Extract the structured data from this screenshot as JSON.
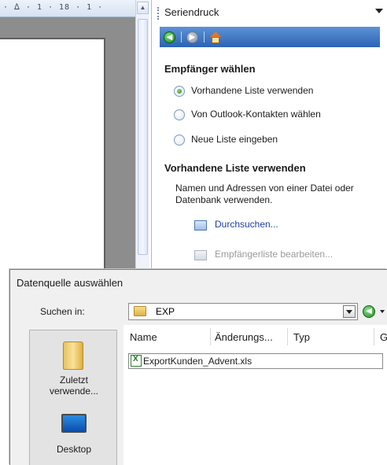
{
  "document": {
    "ruler_text": "· ᐃ · 1 · 18 · 1 ·"
  },
  "task_pane": {
    "title": "Seriendruck",
    "nav": {
      "back_icon": "back-arrow-icon",
      "forward_icon": "forward-arrow-icon",
      "home_icon": "home-icon"
    },
    "section1_heading": "Empfänger wählen",
    "options": [
      {
        "label": "Vorhandene Liste verwenden",
        "checked": true
      },
      {
        "label": "Von Outlook-Kontakten wählen",
        "checked": false
      },
      {
        "label": "Neue Liste eingeben",
        "checked": false
      }
    ],
    "section2_heading": "Vorhandene Liste verwenden",
    "description": "Namen und Adressen von einer Datei oder Datenbank verwenden.",
    "links": [
      {
        "label": "Durchsuchen...",
        "enabled": true
      },
      {
        "label": "Empfängerliste bearbeiten...",
        "enabled": false
      }
    ]
  },
  "dialog": {
    "title": "Datenquelle auswählen",
    "look_in_label": "Suchen in:",
    "look_in_value": "EXP",
    "places": [
      {
        "label_line1": "Zuletzt",
        "label_line2": "verwende...",
        "icon": "recent-folder-icon"
      },
      {
        "label_line1": "Desktop",
        "label_line2": "",
        "icon": "desktop-icon"
      }
    ],
    "columns": [
      "Name",
      "Änderungs...",
      "Typ",
      "G"
    ],
    "files": [
      {
        "name": "ExportKunden_Advent.xls",
        "icon": "excel-file-icon"
      }
    ]
  }
}
